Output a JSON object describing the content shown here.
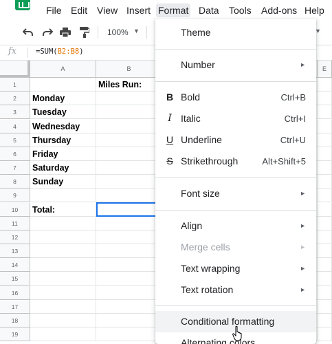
{
  "menubar": {
    "items": [
      "File",
      "Edit",
      "View",
      "Insert",
      "Format",
      "Data",
      "Tools",
      "Add-ons",
      "Help"
    ]
  },
  "toolbar": {
    "zoom": "100%",
    "icons": [
      "undo-icon",
      "redo-icon",
      "print-icon",
      "paint-format-icon"
    ]
  },
  "formula_bar": {
    "fx_label": "fx",
    "formula_prefix": "=SUM(",
    "formula_ref": "B2:B8",
    "formula_suffix": ")"
  },
  "grid": {
    "columns": [
      "A",
      "B",
      "",
      "E"
    ],
    "rows": [
      "1",
      "2",
      "3",
      "4",
      "5",
      "6",
      "7",
      "8",
      "9",
      "10",
      "11",
      "12",
      "13",
      "14",
      "15",
      "16",
      "17",
      "18",
      "19"
    ],
    "header_b1": "Miles Run:",
    "days": [
      "Monday",
      "Tuesday",
      "Wednesday",
      "Thursday",
      "Friday",
      "Saturday",
      "Sunday"
    ],
    "total_label": "Total:",
    "selected_cell": "B10"
  },
  "format_menu": {
    "theme": "Theme",
    "number": "Number",
    "bold": "Bold",
    "bold_shortcut": "Ctrl+B",
    "italic": "Italic",
    "italic_shortcut": "Ctrl+I",
    "underline": "Underline",
    "underline_shortcut": "Ctrl+U",
    "strikethrough": "Strikethrough",
    "strikethrough_shortcut": "Alt+Shift+5",
    "font_size": "Font size",
    "align": "Align",
    "merge_cells": "Merge cells",
    "text_wrapping": "Text wrapping",
    "text_rotation": "Text rotation",
    "conditional_formatting": "Conditional formatting",
    "alternating_colors": "Alternating colors"
  },
  "colors": {
    "accent": "#1a73e8",
    "sheets_green": "#0f9d58",
    "formula_ref": "#e37400"
  }
}
